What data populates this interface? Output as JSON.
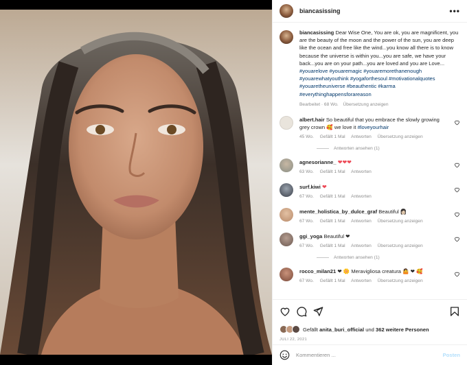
{
  "post": {
    "username": "biancasissing",
    "caption_text": "Dear Wise One, You are ok, you are magnificent, you are the beauty of the moon and the power of the sun, you are deep like the ocean and free like the wind...you know all there is to know because the universe is within you...you are safe, we have your back...you are on your path...you are loved and you are Love...",
    "hashtags": "#youarelove #youaremagic #youaremorethanenough #youarewhatyouthink #yogaforthesoul #motivationalquotes #youaretheuniverse #beauthentic #karma #everythinghappensforareason",
    "edited": "Bearbeitet · 68 Wo.",
    "see_translation": "Übersetzung anzeigen"
  },
  "comments": [
    {
      "user": "albert.hair",
      "text": "So beautiful that you embrace the slowly growing grey crown",
      "emoji_after_text": "🥰",
      "tail_text": " we love it ",
      "tail_hashtag": "#loveyourhair",
      "time": "45 Wo.",
      "likes": "Gefällt 1 Mal",
      "reply": "Antworten",
      "translate": "Übersetzung anzeigen",
      "view_replies": "Antworten ansehen (1)",
      "avatar_color": "#e9e4dc"
    },
    {
      "user": "agnesorianne_",
      "text": "❤❤❤",
      "time": "63 Wo.",
      "likes": "Gefällt 1 Mal",
      "reply": "Antworten",
      "avatar_color": "#8a8f86"
    },
    {
      "user": "surf.kiwi",
      "text": "❤",
      "time": "67 Wo.",
      "likes": "Gefällt 1 Mal",
      "reply": "Antworten",
      "avatar_color": "#3a3f4a"
    },
    {
      "user": "mente_holistica_by_dulce_graf",
      "text": "Beautiful",
      "emoji_after_text": "👩🏻",
      "time": "67 Wo.",
      "likes": "Gefällt 1 Mal",
      "reply": "Antworten",
      "translate": "Übersetzung anzeigen",
      "avatar_color": "#b88a6a"
    },
    {
      "user": "ggi_yoga",
      "text": "Beautiful ❤",
      "time": "67 Wo.",
      "likes": "Gefällt 1 Mal",
      "reply": "Antworten",
      "translate": "Übersetzung anzeigen",
      "view_replies": "Antworten ansehen (1)",
      "avatar_color": "#6d5a52"
    },
    {
      "user": "rocco_milan21",
      "text": "❤ 🌼 Meravigliosa creatura 🤷 ❤ 🥰",
      "time": "67 Wo.",
      "likes": "Gefällt 1 Mal",
      "reply": "Antworten",
      "translate": "Übersetzung anzeigen",
      "avatar_color": "#7a4a3a"
    }
  ],
  "actions": {
    "liked_by_prefix": "Gefällt",
    "liked_by_user": "anita_buri_official",
    "liked_by_suffix_and": "und",
    "liked_by_others": "362 weitere Personen",
    "date": "JULI 22, 2021"
  },
  "composer": {
    "placeholder": "Kommentieren ...",
    "post_label": "Posten"
  },
  "colors": {
    "link": "#00376b",
    "muted": "#8e8e8e",
    "heart": "#ed4956",
    "post_button_disabled": "#b2dffc"
  },
  "icons": [
    "heart-icon",
    "comment-icon",
    "share-icon",
    "bookmark-icon",
    "smiley-icon",
    "more-icon"
  ]
}
